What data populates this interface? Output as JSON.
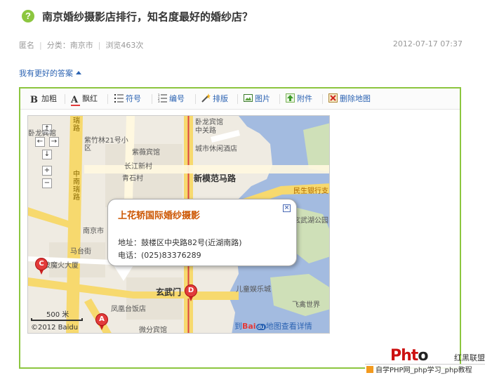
{
  "question": {
    "icon": "question-mark-icon",
    "icon_glyph": "?",
    "title": "南京婚纱摄影店排行，知名度最好的婚纱店？"
  },
  "meta": {
    "author": "匿名",
    "category_label": "分类：",
    "category": "南京市",
    "views": "浏览463次",
    "date": "2012-07-17 07:37"
  },
  "answer_toggle": {
    "label": "我有更好的答案"
  },
  "toolbar": {
    "bold": "加粗",
    "color": "飘红",
    "bullets": "符号",
    "numbering": "编号",
    "format": "排版",
    "image": "图片",
    "attach": "附件",
    "delete_map": "删除地图"
  },
  "map": {
    "labels": {
      "l1": "卧龙宾馆",
      "l2": "中关路",
      "l3": "紫竹林21号小区",
      "l4": "紫薇宾馆",
      "l5": "长江新村",
      "l6": "青石村",
      "l7": "城市休闲酒店",
      "l8": "新模范马路",
      "l9": "民生银行支",
      "l10": "玄武湖公园",
      "l11": "南京市",
      "l12": "马台街",
      "l13": "波魔火大厦",
      "l14": "玄武门",
      "l15": "凤凰台饭店",
      "l16": "儿童娱乐城",
      "l17": "飞禽世界",
      "l18": "微分宾馆",
      "l19": "玄武湖公园",
      "road1": "瑞路",
      "road2": "中南瑞路"
    },
    "controls": {
      "up": "↑",
      "left": "←",
      "right": "→",
      "down": "↓",
      "zoom_in": "+",
      "zoom_out": "−"
    },
    "info_window": {
      "name": "上花轿国际婚纱摄影",
      "address": "地址：鼓楼区中央路82号(近湖南路)",
      "phone": "电话：(025)83376289",
      "close": "×"
    },
    "pins": {
      "a": "A",
      "c": "C",
      "d": "D"
    },
    "scale": "500 米",
    "copyright": "©2012 Baidu",
    "baidu_link": {
      "prefix": "到",
      "bai": "Bai",
      "du": "du",
      "map": "地图",
      "detail": "查看详情"
    }
  },
  "watermark": {
    "logo_a": "Pht",
    "logo_b": "o",
    "cn": "红黑联盟",
    "bar": "自学PHP网_php学习_php教程"
  },
  "colors": {
    "accent_green": "#8cc63f",
    "link_blue": "#2d64b3",
    "pin_red": "#e23b3b",
    "water": "#a3bbe0",
    "road_yellow": "#f7d96e"
  }
}
